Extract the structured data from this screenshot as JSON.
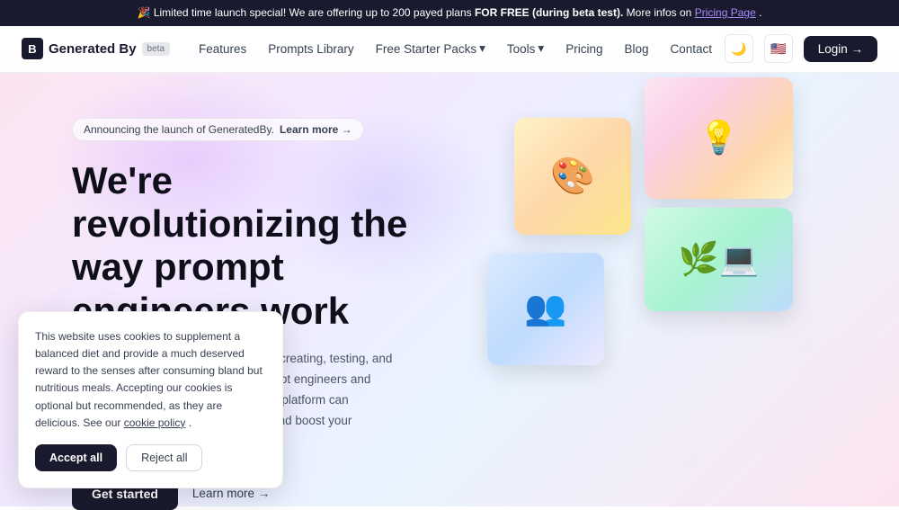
{
  "banner": {
    "prefix": "🎉 Limited time launch special!",
    "text": " We are offering up to 200 payed plans ",
    "highlight": "FOR FREE (during beta test).",
    "suffix": " More infos on ",
    "link_text": "Pricing Page",
    "link_suffix": "."
  },
  "navbar": {
    "logo_text": "Generated By",
    "logo_icon": "B",
    "beta_label": "beta",
    "links": [
      {
        "label": "Features",
        "has_dropdown": false
      },
      {
        "label": "Prompts Library",
        "has_dropdown": false
      },
      {
        "label": "Free Starter Packs",
        "has_dropdown": true
      },
      {
        "label": "Tools",
        "has_dropdown": true
      },
      {
        "label": "Pricing",
        "has_dropdown": false
      },
      {
        "label": "Blog",
        "has_dropdown": false
      },
      {
        "label": "Contact",
        "has_dropdown": false
      }
    ],
    "theme_icon": "🌙",
    "flag_icon": "🇺🇸",
    "login_label": "Login →"
  },
  "hero": {
    "announce_text": "Announcing the launch of GeneratedBy.",
    "announce_link": "Learn more →",
    "title": "We're revolutionizing the way prompt engineers work",
    "description": "GeneratedBy simplifies the process of creating, testing, and sharing AI-generated prompts for prompt engineers and digital workers alike. Discover how our platform can revolutionize your work with prompts and boost your productivity.",
    "cta_primary": "Get started",
    "cta_secondary": "Learn more →"
  },
  "images": [
    {
      "id": "painter",
      "emoji": "🎨",
      "alt": "Artist painting"
    },
    {
      "id": "meeting",
      "emoji": "👥",
      "alt": "Team meeting"
    },
    {
      "id": "lightbulb",
      "emoji": "💡",
      "alt": "Creative ideas"
    },
    {
      "id": "plants",
      "emoji": "💻",
      "alt": "Working with plants"
    }
  ],
  "cookie": {
    "text": "This website uses cookies to supplement a balanced diet and provide a much deserved reward to the senses after consuming bland but nutritious meals. Accepting our cookies is optional but recommended, as they are delicious. See our ",
    "link_text": "cookie policy",
    "link_suffix": ".",
    "accept_label": "Accept all",
    "reject_label": "Reject all"
  }
}
